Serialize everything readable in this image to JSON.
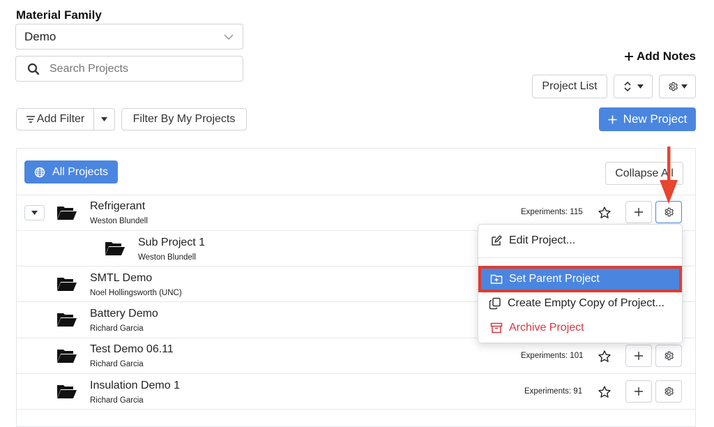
{
  "material_family": {
    "label": "Material Family",
    "selected": "Demo"
  },
  "search": {
    "placeholder": "Search Projects"
  },
  "toolbar": {
    "add_notes_label": "Add Notes",
    "project_list_label": "Project List",
    "add_filter_label": "Add Filter",
    "filter_my_projects_label": "Filter By My Projects",
    "new_project_label": "New Project"
  },
  "panel": {
    "all_projects_label": "All Projects",
    "collapse_all_label": "Collapse All"
  },
  "projects": [
    {
      "title": "Refrigerant",
      "owner": "Weston Blundell",
      "experiments": "Experiments: 115"
    },
    {
      "title": "Sub Project 1",
      "owner": "Weston Blundell"
    },
    {
      "title": "SMTL Demo",
      "owner": "Noel Hollingsworth (UNC)"
    },
    {
      "title": "Battery Demo",
      "owner": "Richard Garcia"
    },
    {
      "title": "Test Demo 06.11",
      "owner": "Richard Garcia",
      "experiments": "Experiments: 101"
    },
    {
      "title": "Insulation Demo 1",
      "owner": "Richard Garcia",
      "experiments": "Experiments: 91"
    }
  ],
  "context_menu": {
    "items": [
      {
        "label": "Edit Project...",
        "icon": "edit-icon"
      },
      {
        "label": "Set Parent Project",
        "icon": "folder-plus-icon"
      },
      {
        "label": "Create Empty Copy of Project...",
        "icon": "copy-icon"
      },
      {
        "label": "Archive Project",
        "icon": "archive-icon"
      }
    ]
  },
  "colors": {
    "primary": "#4a86e0",
    "highlight_border": "#e23b2e",
    "danger": "#d9363e",
    "arrow": "#e8452f"
  }
}
